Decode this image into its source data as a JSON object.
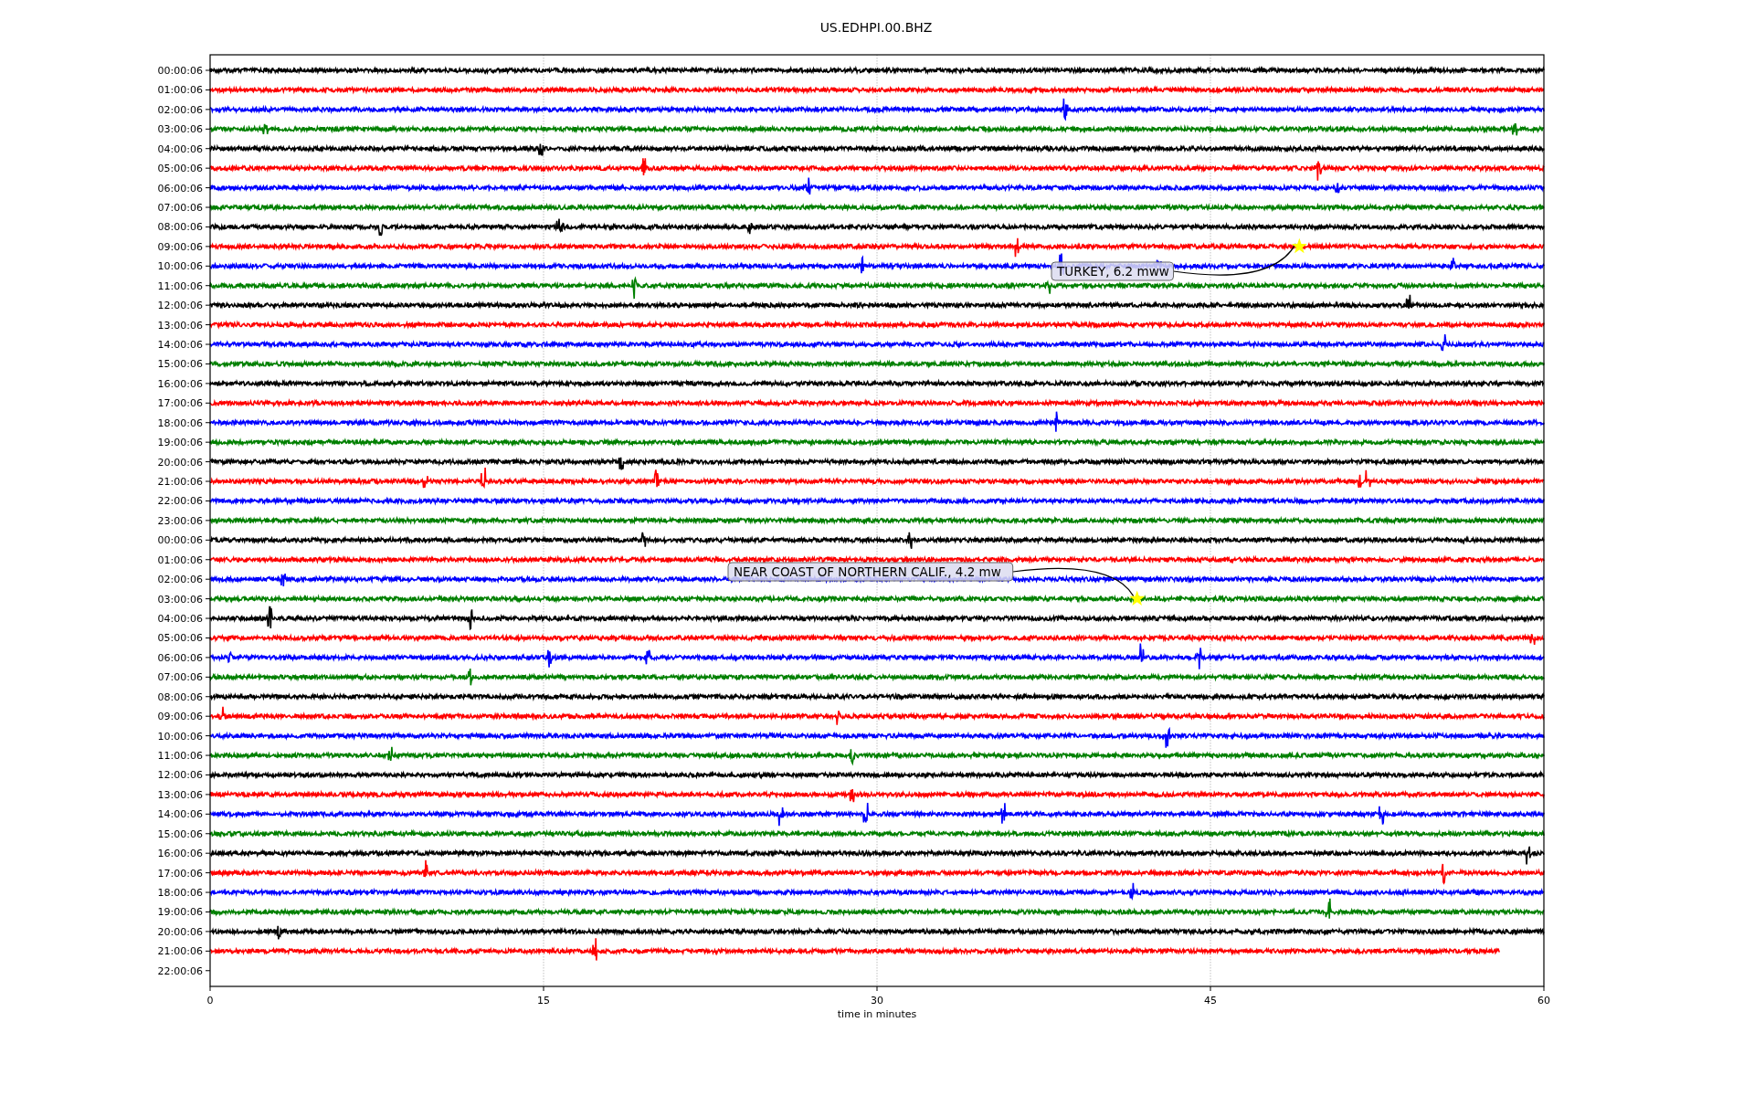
{
  "figure": {
    "title": "US.EDHPI.00.BHZ",
    "x_label": "time in minutes",
    "x_ticks": [
      "0",
      "15",
      "30",
      "45",
      "60"
    ],
    "rows": [
      {
        "label": "00:00:06",
        "color": "#000000"
      },
      {
        "label": "01:00:06",
        "color": "#ff0000"
      },
      {
        "label": "02:00:06",
        "color": "#0000ff"
      },
      {
        "label": "03:00:06",
        "color": "#008000"
      },
      {
        "label": "04:00:06",
        "color": "#000000"
      },
      {
        "label": "05:00:06",
        "color": "#ff0000"
      },
      {
        "label": "06:00:06",
        "color": "#0000ff"
      },
      {
        "label": "07:00:06",
        "color": "#008000"
      },
      {
        "label": "08:00:06",
        "color": "#000000"
      },
      {
        "label": "09:00:06",
        "color": "#ff0000"
      },
      {
        "label": "10:00:06",
        "color": "#0000ff"
      },
      {
        "label": "11:00:06",
        "color": "#008000"
      },
      {
        "label": "12:00:06",
        "color": "#000000"
      },
      {
        "label": "13:00:06",
        "color": "#ff0000"
      },
      {
        "label": "14:00:06",
        "color": "#0000ff"
      },
      {
        "label": "15:00:06",
        "color": "#008000"
      },
      {
        "label": "16:00:06",
        "color": "#000000"
      },
      {
        "label": "17:00:06",
        "color": "#ff0000"
      },
      {
        "label": "18:00:06",
        "color": "#0000ff"
      },
      {
        "label": "19:00:06",
        "color": "#008000"
      },
      {
        "label": "20:00:06",
        "color": "#000000"
      },
      {
        "label": "21:00:06",
        "color": "#ff0000"
      },
      {
        "label": "22:00:06",
        "color": "#0000ff"
      },
      {
        "label": "23:00:06",
        "color": "#008000"
      },
      {
        "label": "00:00:06",
        "color": "#000000"
      },
      {
        "label": "01:00:06",
        "color": "#ff0000"
      },
      {
        "label": "02:00:06",
        "color": "#0000ff"
      },
      {
        "label": "03:00:06",
        "color": "#008000"
      },
      {
        "label": "04:00:06",
        "color": "#000000"
      },
      {
        "label": "05:00:06",
        "color": "#ff0000"
      },
      {
        "label": "06:00:06",
        "color": "#0000ff"
      },
      {
        "label": "07:00:06",
        "color": "#008000"
      },
      {
        "label": "08:00:06",
        "color": "#000000"
      },
      {
        "label": "09:00:06",
        "color": "#ff0000"
      },
      {
        "label": "10:00:06",
        "color": "#0000ff"
      },
      {
        "label": "11:00:06",
        "color": "#008000"
      },
      {
        "label": "12:00:06",
        "color": "#000000"
      },
      {
        "label": "13:00:06",
        "color": "#ff0000"
      },
      {
        "label": "14:00:06",
        "color": "#0000ff"
      },
      {
        "label": "15:00:06",
        "color": "#008000"
      },
      {
        "label": "16:00:06",
        "color": "#000000"
      },
      {
        "label": "17:00:06",
        "color": "#ff0000"
      },
      {
        "label": "18:00:06",
        "color": "#0000ff"
      },
      {
        "label": "19:00:06",
        "color": "#008000"
      },
      {
        "label": "20:00:06",
        "color": "#000000"
      },
      {
        "label": "21:00:06",
        "color": "#ff0000"
      },
      {
        "label": "22:00:06"
      }
    ],
    "annotations": [
      "TURKEY, 6.2 mww",
      "NEAR COAST OF NORTHERN CALIF., 4.2 mw"
    ]
  }
}
